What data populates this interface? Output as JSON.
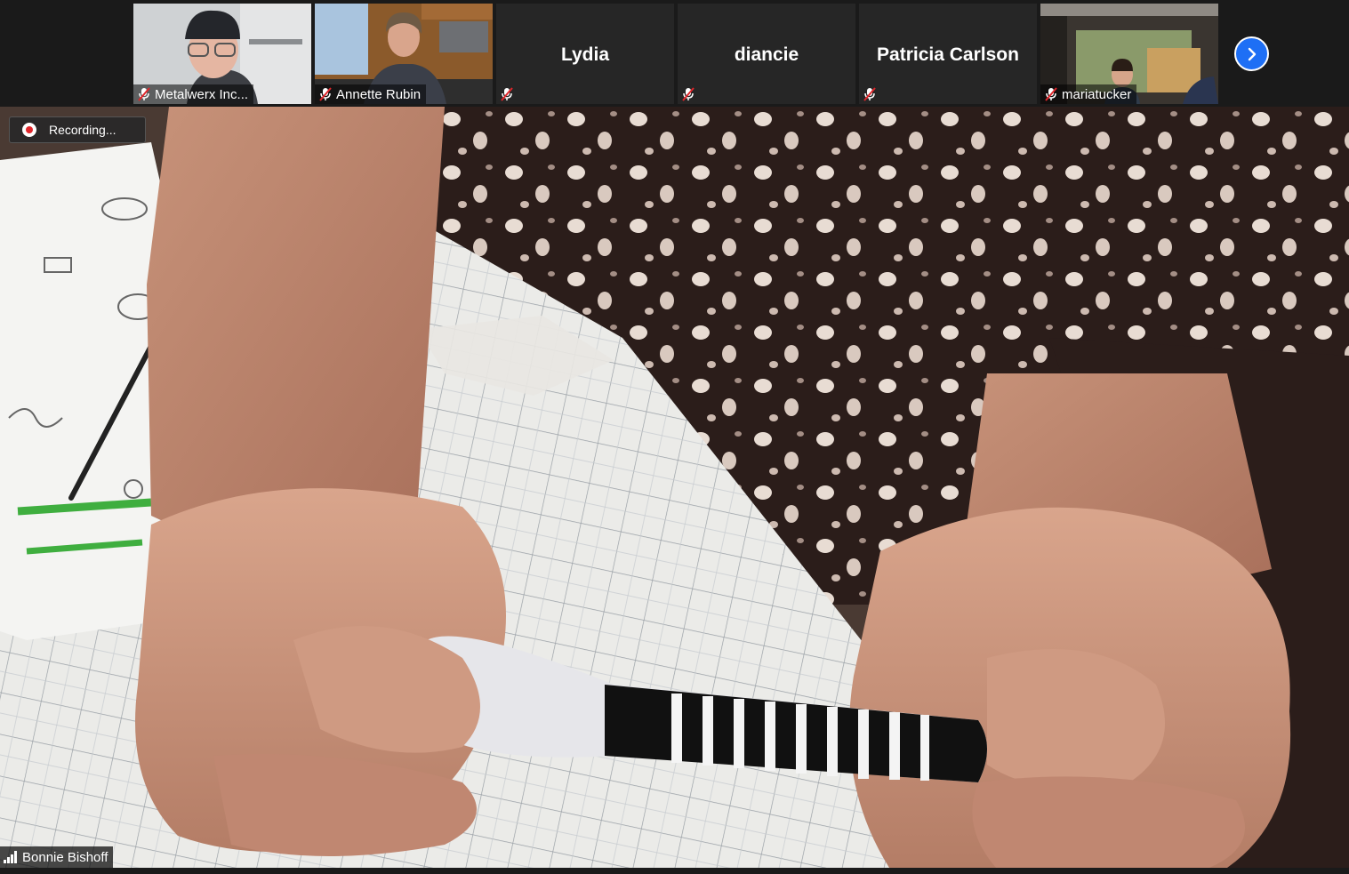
{
  "participants": [
    {
      "name": "Metalwerx Inc...",
      "muted": true,
      "video": true
    },
    {
      "name": "Annette Rubin",
      "muted": true,
      "video": true
    },
    {
      "name": "Lydia",
      "muted": true,
      "video": false
    },
    {
      "name": "diancie",
      "muted": true,
      "video": false
    },
    {
      "name": "Patricia Carlson",
      "muted": true,
      "video": false
    },
    {
      "name": "mariatucker",
      "muted": true,
      "video": true
    }
  ],
  "next_page_icon": "chevron-right-icon",
  "recording": {
    "label": "Recording..."
  },
  "active_speaker": {
    "name": "Bonnie Bishoff",
    "icon": "signal-bars-icon"
  },
  "colors": {
    "accent": "#1e6ff5",
    "mute_red": "#e0262b",
    "recording_red": "#e0262b"
  }
}
